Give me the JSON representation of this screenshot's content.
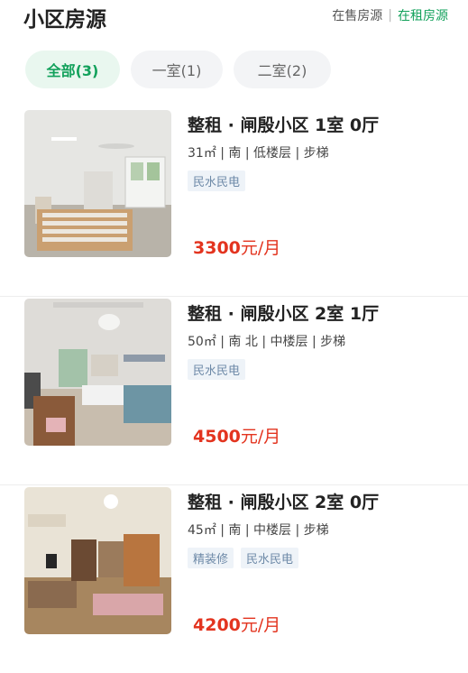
{
  "header": {
    "title": "小区房源",
    "sale_label": "在售房源",
    "divider": "|",
    "rent_label": "在租房源"
  },
  "tabs": [
    {
      "label": "全部(3)",
      "active": true
    },
    {
      "label": "一室(1)",
      "active": false
    },
    {
      "label": "二室(2)",
      "active": false
    }
  ],
  "listings": [
    {
      "title": "整租 · 闸殷小区 1室 0厅",
      "meta": "31㎡ | 南 | 低楼层 | 步梯",
      "tags": [
        "民水民电"
      ],
      "price_amount": "3300",
      "price_unit": "元/月"
    },
    {
      "title": "整租 · 闸殷小区 2室 1厅",
      "meta": "50㎡ | 南 北 | 中楼层 | 步梯",
      "tags": [
        "民水民电"
      ],
      "price_amount": "4500",
      "price_unit": "元/月"
    },
    {
      "title": "整租 · 闸殷小区 2室 0厅",
      "meta": "45㎡ | 南 | 中楼层 | 步梯",
      "tags": [
        "精装修",
        "民水民电"
      ],
      "price_amount": "4200",
      "price_unit": "元/月"
    }
  ]
}
